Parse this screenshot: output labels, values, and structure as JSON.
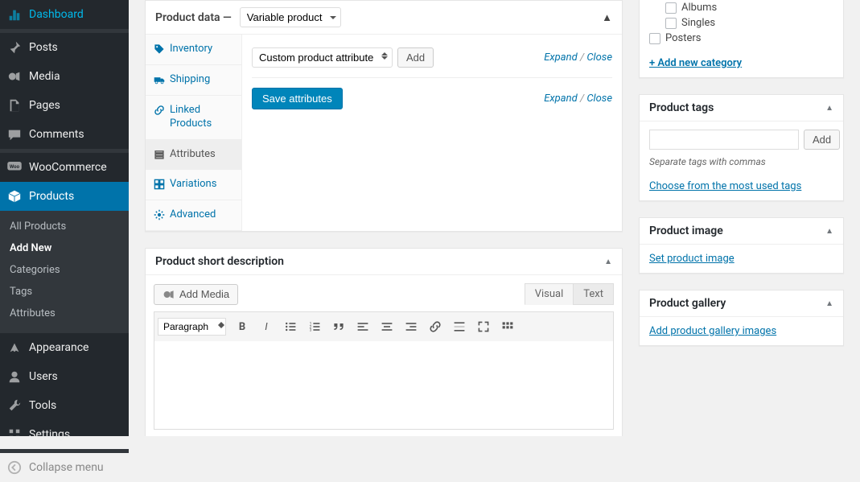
{
  "sidebar": {
    "items": [
      {
        "label": "Dashboard",
        "icon": "dashboard"
      },
      {
        "label": "Posts",
        "icon": "pin"
      },
      {
        "label": "Media",
        "icon": "media"
      },
      {
        "label": "Pages",
        "icon": "pages"
      },
      {
        "label": "Comments",
        "icon": "comments"
      },
      {
        "label": "WooCommerce",
        "icon": "woo"
      },
      {
        "label": "Products",
        "icon": "products",
        "active": true
      },
      {
        "label": "Appearance",
        "icon": "appearance"
      },
      {
        "label": "Users",
        "icon": "users"
      },
      {
        "label": "Tools",
        "icon": "tools"
      },
      {
        "label": "Settings",
        "icon": "settings"
      },
      {
        "label": "Collapse menu",
        "icon": "collapse"
      }
    ],
    "sub": [
      {
        "label": "All Products"
      },
      {
        "label": "Add New",
        "current": true
      },
      {
        "label": "Categories"
      },
      {
        "label": "Tags"
      },
      {
        "label": "Attributes"
      }
    ]
  },
  "productData": {
    "title": "Product data —",
    "typeSelected": "Variable product",
    "tabs": [
      {
        "label": "Inventory",
        "icon": "inventory"
      },
      {
        "label": "Shipping",
        "icon": "shipping"
      },
      {
        "label": "Linked Products",
        "icon": "link"
      },
      {
        "label": "Attributes",
        "icon": "attributes",
        "active": true
      },
      {
        "label": "Variations",
        "icon": "variations"
      },
      {
        "label": "Advanced",
        "icon": "advanced"
      }
    ],
    "attrSelect": "Custom product attribute",
    "addBtn": "Add",
    "expand": "Expand",
    "close": "Close",
    "saveBtn": "Save attributes"
  },
  "shortDesc": {
    "title": "Product short description",
    "addMedia": "Add Media",
    "tabVisual": "Visual",
    "tabText": "Text",
    "formatSelected": "Paragraph"
  },
  "categories": {
    "items": [
      {
        "label": "Albums",
        "indent": true
      },
      {
        "label": "Singles",
        "indent": true
      },
      {
        "label": "Posters",
        "indent": false
      }
    ],
    "addNew": "+ Add new category"
  },
  "tags": {
    "title": "Product tags",
    "addBtn": "Add",
    "hint": "Separate tags with commas",
    "chooseLink": "Choose from the most used tags"
  },
  "productImage": {
    "title": "Product image",
    "link": "Set product image"
  },
  "productGallery": {
    "title": "Product gallery",
    "link": "Add product gallery images"
  }
}
